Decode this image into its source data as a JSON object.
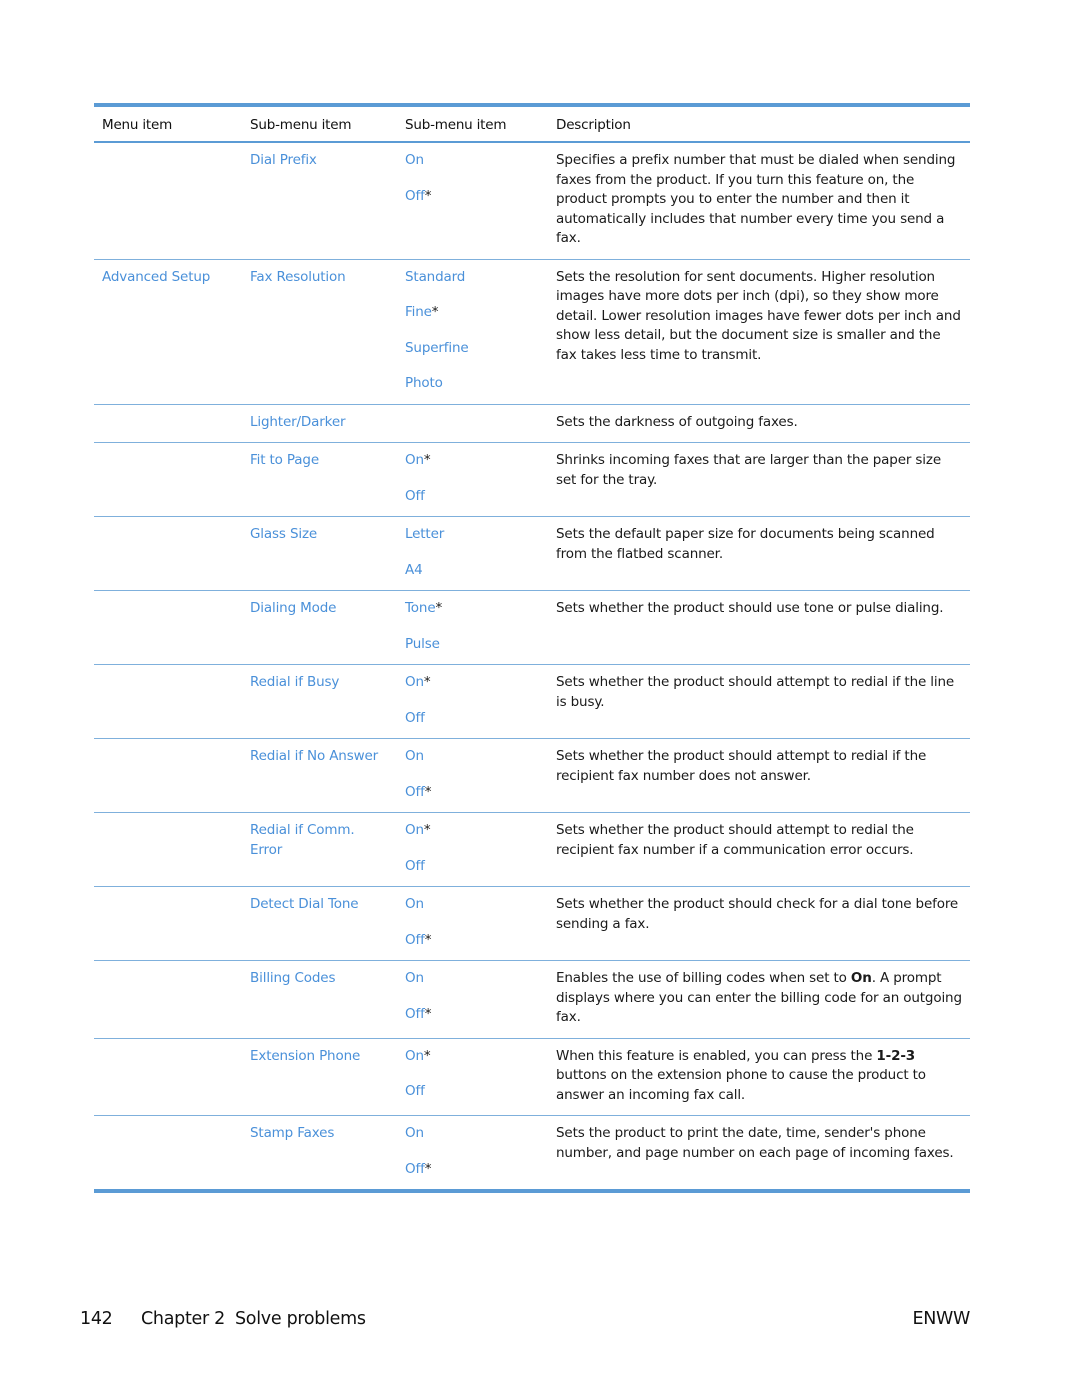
{
  "table": {
    "headers": [
      "Menu item",
      "Sub-menu item",
      "Sub-menu item",
      "Description"
    ],
    "rows": [
      {
        "menu": "",
        "submenu": "Dial Prefix",
        "options": [
          {
            "label": "On",
            "default": false
          },
          {
            "label": "Off",
            "default": true
          }
        ],
        "description": "Specifies a prefix number that must be dialed when sending faxes from the product. If you turn this feature on, the product prompts you to enter the number and then it automatically includes that number every time you send a fax."
      },
      {
        "menu": "Advanced Setup",
        "submenu": "Fax Resolution",
        "options": [
          {
            "label": "Standard",
            "default": false
          },
          {
            "label": "Fine",
            "default": true
          },
          {
            "label": "Superfine",
            "default": false
          },
          {
            "label": "Photo",
            "default": false
          }
        ],
        "description": "Sets the resolution for sent documents. Higher resolution images have more dots per inch (dpi), so they show more detail. Lower resolution images have fewer dots per inch and show less detail, but the document size is smaller and the fax takes less time to transmit."
      },
      {
        "menu": "",
        "submenu": "Lighter/Darker",
        "options": [],
        "description": "Sets the darkness of outgoing faxes."
      },
      {
        "menu": "",
        "submenu": "Fit to Page",
        "options": [
          {
            "label": "On",
            "default": true
          },
          {
            "label": "Off",
            "default": false
          }
        ],
        "description": "Shrinks incoming faxes that are larger than the paper size set for the tray."
      },
      {
        "menu": "",
        "submenu": "Glass Size",
        "options": [
          {
            "label": "Letter",
            "default": false
          },
          {
            "label": "A4",
            "default": false
          }
        ],
        "description": "Sets the default paper size for documents being scanned from the flatbed scanner."
      },
      {
        "menu": "",
        "submenu": "Dialing Mode",
        "options": [
          {
            "label": "Tone",
            "default": true
          },
          {
            "label": "Pulse",
            "default": false
          }
        ],
        "description": "Sets whether the product should use tone or pulse dialing."
      },
      {
        "menu": "",
        "submenu": "Redial if Busy",
        "options": [
          {
            "label": "On",
            "default": true
          },
          {
            "label": "Off",
            "default": false
          }
        ],
        "description": "Sets whether the product should attempt to redial if the line is busy."
      },
      {
        "menu": "",
        "submenu": "Redial if No Answer",
        "options": [
          {
            "label": "On",
            "default": false
          },
          {
            "label": "Off",
            "default": true
          }
        ],
        "description": "Sets whether the product should attempt to redial if the recipient fax number does not answer."
      },
      {
        "menu": "",
        "submenu": "Redial if Comm. Error",
        "options": [
          {
            "label": "On",
            "default": true
          },
          {
            "label": "Off",
            "default": false
          }
        ],
        "description": "Sets whether the product should attempt to redial the recipient fax number if a communication error occurs."
      },
      {
        "menu": "",
        "submenu": "Detect Dial Tone",
        "options": [
          {
            "label": "On",
            "default": false
          },
          {
            "label": "Off",
            "default": true
          }
        ],
        "description": "Sets whether the product should check for a dial tone before sending a fax."
      },
      {
        "menu": "",
        "submenu": "Billing Codes",
        "options": [
          {
            "label": "On",
            "default": false
          },
          {
            "label": "Off",
            "default": true
          }
        ],
        "description_parts": [
          {
            "text": "Enables the use of billing codes when set to ",
            "bold": false
          },
          {
            "text": "On",
            "bold": true
          },
          {
            "text": ". A prompt displays where you can enter the billing code for an outgoing fax.",
            "bold": false
          }
        ]
      },
      {
        "menu": "",
        "submenu": "Extension Phone",
        "options": [
          {
            "label": "On",
            "default": true
          },
          {
            "label": "Off",
            "default": false
          }
        ],
        "description_parts": [
          {
            "text": "When this feature is enabled, you can press the ",
            "bold": false
          },
          {
            "text": "1-2-3",
            "bold": true
          },
          {
            "text": " buttons on the extension phone to cause the product to answer an incoming fax call.",
            "bold": false
          }
        ]
      },
      {
        "menu": "",
        "submenu": "Stamp Faxes",
        "options": [
          {
            "label": "On",
            "default": false
          },
          {
            "label": "Off",
            "default": true
          }
        ],
        "description": "Sets the product to print the date, time, sender's phone number, and page number on each page of incoming faxes."
      }
    ],
    "default_marker": "*"
  },
  "footer": {
    "page_number": "142",
    "chapter": "Chapter 2",
    "section": "Solve problems",
    "brand": "ENWW"
  },
  "colors": {
    "rule": "#5b9bd5",
    "link": "#4a90d9"
  }
}
